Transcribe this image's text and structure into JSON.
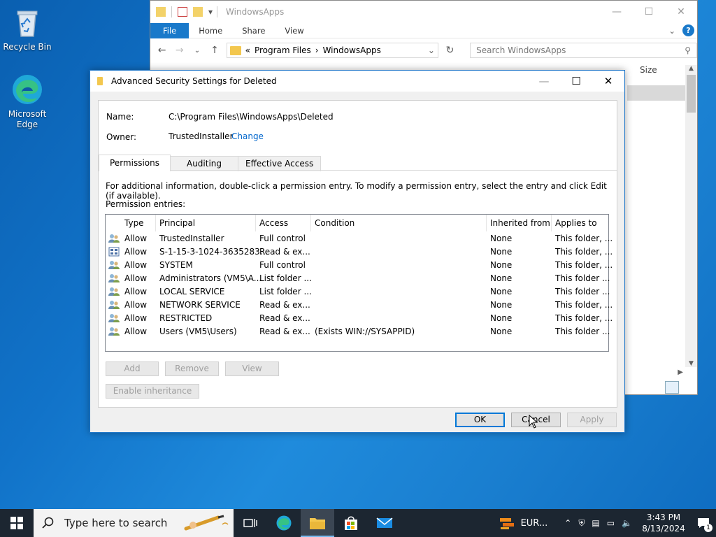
{
  "desktop": {
    "icons": [
      {
        "label": "Recycle Bin"
      },
      {
        "label": "Microsoft Edge"
      }
    ]
  },
  "explorer": {
    "title": "WindowsApps",
    "ribbon_tabs": [
      "File",
      "Home",
      "Share",
      "View"
    ],
    "breadcrumb": {
      "overflow": "«",
      "parts": [
        "Program Files",
        "WindowsApps"
      ],
      "separator": "›"
    },
    "search_placeholder": "Search WindowsApps",
    "size_column": "Size"
  },
  "dialog": {
    "title": "Advanced Security Settings for Deleted",
    "name_label": "Name:",
    "name_value": "C:\\Program Files\\WindowsApps\\Deleted",
    "owner_label": "Owner:",
    "owner_value": "TrustedInstaller",
    "change_link": "Change",
    "tabs": [
      "Permissions",
      "Auditing",
      "Effective Access"
    ],
    "info_text": "For additional information, double-click a permission entry. To modify a permission entry, select the entry and click Edit (if available).",
    "entries_label": "Permission entries:",
    "columns": [
      "Type",
      "Principal",
      "Access",
      "Condition",
      "Inherited from",
      "Applies to"
    ],
    "rows": [
      {
        "icon": "users-icon",
        "type": "Allow",
        "principal": "TrustedInstaller",
        "access": "Full control",
        "condition": "",
        "inherited": "None",
        "applies": "This folder, ..."
      },
      {
        "icon": "capability-icon",
        "type": "Allow",
        "principal": "S-1-15-3-1024-3635283...",
        "access": "Read & ex...",
        "condition": "",
        "inherited": "None",
        "applies": "This folder, ..."
      },
      {
        "icon": "users-icon",
        "type": "Allow",
        "principal": "SYSTEM",
        "access": "Full control",
        "condition": "",
        "inherited": "None",
        "applies": "This folder, ..."
      },
      {
        "icon": "users-icon",
        "type": "Allow",
        "principal": "Administrators (VM5\\A...",
        "access": "List folder ...",
        "condition": "",
        "inherited": "None",
        "applies": "This folder ..."
      },
      {
        "icon": "users-icon",
        "type": "Allow",
        "principal": "LOCAL SERVICE",
        "access": "List folder ...",
        "condition": "",
        "inherited": "None",
        "applies": "This folder ..."
      },
      {
        "icon": "users-icon",
        "type": "Allow",
        "principal": "NETWORK SERVICE",
        "access": "Read & ex...",
        "condition": "",
        "inherited": "None",
        "applies": "This folder, ..."
      },
      {
        "icon": "users-icon",
        "type": "Allow",
        "principal": "RESTRICTED",
        "access": "Read & ex...",
        "condition": "",
        "inherited": "None",
        "applies": "This folder, ..."
      },
      {
        "icon": "users-icon",
        "type": "Allow",
        "principal": "Users (VM5\\Users)",
        "access": "Read & ex...",
        "condition": "(Exists WIN://SYSAPPID)",
        "inherited": "None",
        "applies": "This folder ..."
      }
    ],
    "buttons": {
      "add": "Add",
      "remove": "Remove",
      "view": "View",
      "enable_inheritance": "Enable inheritance",
      "ok": "OK",
      "cancel": "Cancel",
      "apply": "Apply"
    }
  },
  "taskbar": {
    "search_placeholder": "Type here to search",
    "weather": "EUR...",
    "time": "3:43 PM",
    "date": "8/13/2024",
    "notification_count": "1"
  },
  "colors": {
    "accent": "#0078d7",
    "link": "#0066cc",
    "taskbar": "#1c2631"
  }
}
